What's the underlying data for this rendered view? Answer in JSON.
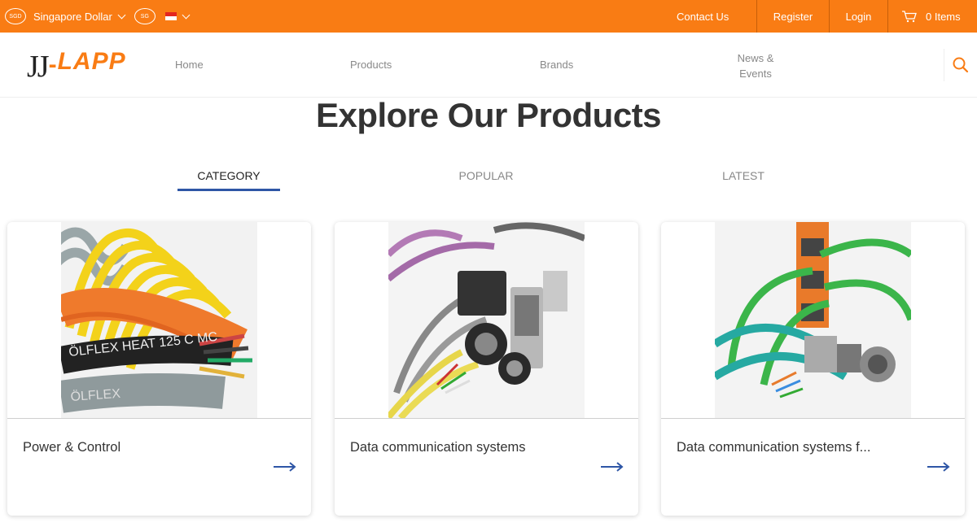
{
  "topbar": {
    "currency_code": "SGD",
    "currency_label": "Singapore Dollar",
    "country_code": "SG",
    "links": {
      "contact": "Contact Us",
      "register": "Register",
      "login": "Login",
      "cart": "0 Items"
    },
    "bg_color": "#f97c14"
  },
  "header": {
    "logo": {
      "jj": "JJ",
      "dash": "-",
      "lapp": "LAPP"
    },
    "nav": {
      "home": "Home",
      "products": "Products",
      "brands": "Brands",
      "news_line1": "News &",
      "news_line2": "Events"
    },
    "search_icon": "search-icon"
  },
  "main": {
    "title": "Explore Our Products",
    "tabs": [
      {
        "label": "CATEGORY",
        "active": true
      },
      {
        "label": "POPULAR",
        "active": false
      },
      {
        "label": "LATEST",
        "active": false
      }
    ],
    "cards": [
      {
        "title": "Power & Control",
        "icon": "arrow-right-icon"
      },
      {
        "title": "Data communication systems",
        "icon": "arrow-right-icon"
      },
      {
        "title": "Data communication systems f...",
        "icon": "arrow-right-icon"
      }
    ]
  },
  "colors": {
    "accent": "#f97c14",
    "tab_underline": "#2e56a6",
    "arrow": "#2e56a6"
  }
}
